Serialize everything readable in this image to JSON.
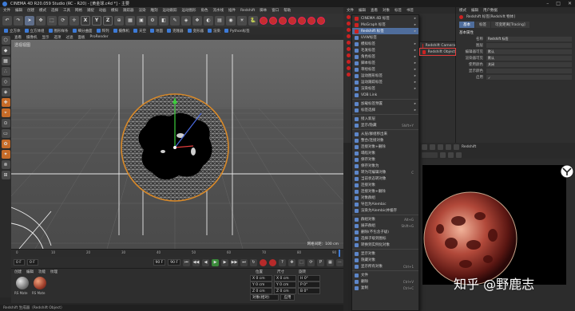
{
  "window": {
    "title": "CINEMA 4D R20.059 Studio (RC - R20) - [黄金球.c4d *] - 主要"
  },
  "menu": [
    "文件",
    "编辑",
    "创建",
    "模式",
    "选择",
    "工具",
    "网格",
    "捕捉",
    "动画",
    "模拟",
    "跟踪器",
    "渲染",
    "雕刻",
    "运动跟踪",
    "运动图形",
    "角色",
    "流水线",
    "插件",
    "Redshift",
    "脚本",
    "窗口",
    "帮助"
  ],
  "toolbar": {
    "axis_x": "X",
    "axis_y": "Y",
    "axis_z": "Z"
  },
  "modebar": [
    "立方体",
    "立方体组",
    "图形样条",
    "细分曲面",
    "阵列",
    "摄像机",
    "天空",
    "地面",
    "克隆器",
    "变形器",
    "渲染",
    "Python标签"
  ],
  "viewport": {
    "menu": [
      "查看",
      "摄像机",
      "显示",
      "选项",
      "过滤",
      "面板",
      "ProRender"
    ],
    "label": "透视视图",
    "grid_distance": "网格间距：100 cm"
  },
  "timeline": {
    "ticks": [
      "0",
      "10",
      "20",
      "30",
      "40",
      "50",
      "60",
      "70",
      "80",
      "90"
    ],
    "start": "0 F",
    "end": "90 F",
    "current": "90 F"
  },
  "materials": {
    "menu": [
      "创建",
      "编辑",
      "功能",
      "纹理"
    ],
    "items": [
      "RS Mate",
      "RS Mate"
    ]
  },
  "coords": {
    "headers": [
      "位置",
      "尺寸",
      "旋转"
    ],
    "rows": [
      [
        "X 0 cm",
        "X 0 cm",
        "H 0°"
      ],
      [
        "Y 0 cm",
        "Y 0 cm",
        "P 0°"
      ],
      [
        "Z 0 cm",
        "Z 0 cm",
        "B 0°"
      ]
    ],
    "apply": "应用",
    "mode": "对象(相对)"
  },
  "status": "Redshift 生成器（Redshift Object）",
  "object_manager": {
    "menu": [
      "文件",
      "编辑",
      "查看",
      "对象",
      "标签",
      "书签"
    ]
  },
  "context_menu": {
    "items": [
      {
        "label": "CINEMA 4D 标签",
        "arrow": true
      },
      {
        "label": "MoGraph 标签",
        "arrow": true
      },
      {
        "label": "Redshift 标签",
        "arrow": true,
        "highlight": true
      },
      {
        "label": "UVW标签"
      },
      {
        "label": "模拟标签",
        "arrow": true
      },
      {
        "label": "毛发标签",
        "arrow": true
      },
      {
        "label": "角色标签",
        "arrow": true
      },
      {
        "label": "脚本标签",
        "arrow": true
      },
      {
        "label": "草绘标签",
        "arrow": true
      },
      {
        "label": "运动图形标签",
        "arrow": true
      },
      {
        "label": "运动跟踪标签",
        "arrow": true
      },
      {
        "label": "渲染标签",
        "arrow": true
      },
      {
        "label": "VDB Link"
      },
      {
        "sep": true
      },
      {
        "label": "加载标签预置",
        "arrow": true
      },
      {
        "label": "标签选择",
        "arrow": true
      },
      {
        "sep": true
      },
      {
        "label": "接入新层"
      },
      {
        "label": "显示/隐藏",
        "shortcut": "Shift+Y"
      },
      {
        "sep": true
      },
      {
        "label": "从层/群组移出来"
      },
      {
        "label": "整合/连接对象"
      },
      {
        "label": "连接对象+删除"
      },
      {
        "label": "塌陷对象"
      },
      {
        "label": "保存对象"
      },
      {
        "label": "保存对象为"
      },
      {
        "label": "转为可编辑对象",
        "shortcut": "C"
      },
      {
        "label": "当前状态转对象"
      },
      {
        "label": "连接对象"
      },
      {
        "label": "连接对象+删除"
      },
      {
        "label": "对象群组"
      },
      {
        "label": "导出为Alembic"
      },
      {
        "label": "渲染为Alembic并缓存"
      },
      {
        "sep": true
      },
      {
        "label": "群组对象",
        "shortcut": "Alt+G"
      },
      {
        "label": "展开群组",
        "shortcut": "Shift+G"
      },
      {
        "label": "删除(不包含子级)"
      },
      {
        "label": "选择子级到图标"
      },
      {
        "label": "转换到实例化对象"
      },
      {
        "sep": true
      },
      {
        "label": "显示对象"
      },
      {
        "label": "隐藏对象"
      },
      {
        "label": "显示所有对象",
        "shortcut": "Ctrl+1"
      },
      {
        "sep": true
      },
      {
        "label": "文件"
      },
      {
        "label": "删除",
        "shortcut": "Ctrl+V"
      },
      {
        "label": "复制",
        "shortcut": "Ctrl+C"
      }
    ],
    "submenu": [
      "Redshift Camera",
      "Redshift Object"
    ]
  },
  "properties": {
    "menu": [
      "模式",
      "编辑",
      "用户数据"
    ],
    "object": "Redshift 标签[Redshift 物体]",
    "tabs": [
      "基本",
      "标签",
      "可变距离[Tracing]"
    ],
    "section": "基本属性",
    "rows": [
      [
        "名称",
        "Redshift 标签"
      ],
      [
        "图层",
        ""
      ],
      [
        "编辑器可见",
        "默认"
      ],
      [
        "渲染器可见",
        "默认"
      ],
      [
        "使用颜色",
        "关闭"
      ],
      [
        "显示颜色",
        ""
      ],
      [
        "启用",
        "✓"
      ]
    ]
  },
  "render_view": {
    "label": "Redshift"
  },
  "watermark": "知乎 @野鹿志"
}
